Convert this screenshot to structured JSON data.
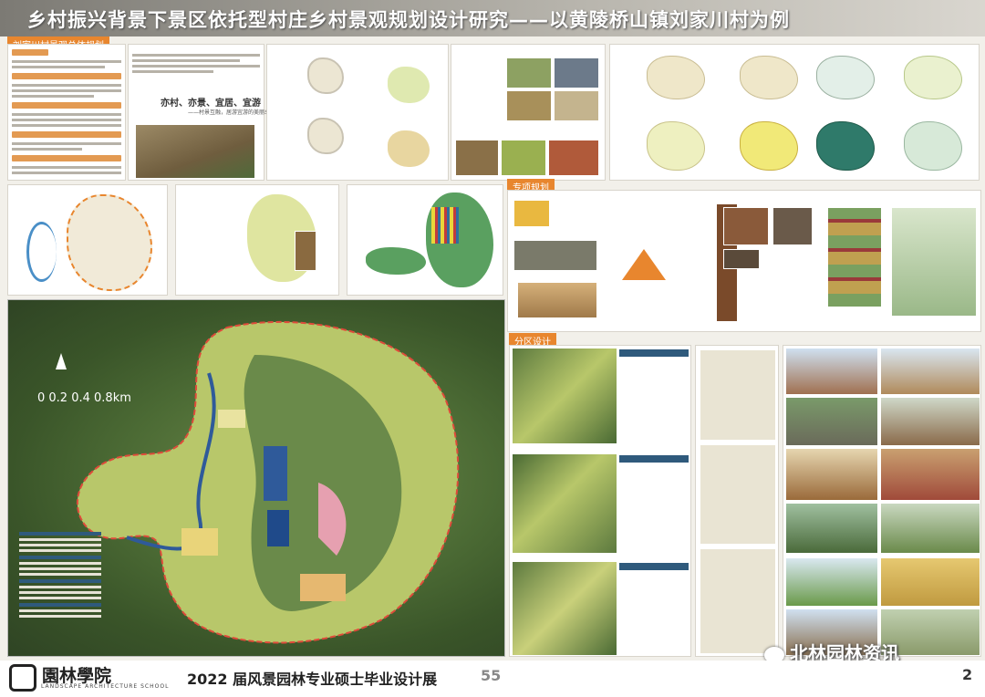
{
  "header": {
    "title": "乡村振兴背景下景区依托型村庄乡村景观规划设计研究——以黄陵桥山镇刘家川村为例"
  },
  "sections": {
    "overall": "刘家川村景观总体规划",
    "special": "专项规划",
    "zoning": "分区设计"
  },
  "concept": {
    "slogan": "亦村、亦景、宜居、宜游",
    "slogan_sub": "——村景互融，居游宜游的美丽乡村"
  },
  "map": {
    "scale_label": "0  0.2 0.4       0.8km",
    "north_icon": "north-arrow-icon"
  },
  "footer": {
    "logo_text": "園林學院",
    "logo_sub": "LANDSCAPE  ARCHITECTURE SCHOOL",
    "exhibition": "2022 届风景园林专业硕士毕业设计展",
    "exhibition_number": "55",
    "page_number": "2"
  },
  "watermark": {
    "text": "北林园林资讯",
    "icon": "wechat-icon"
  },
  "colors": {
    "accent_orange": "#e8862e",
    "legend_blue": "#2f5a7c",
    "banner_gray": "#7c7a74"
  }
}
